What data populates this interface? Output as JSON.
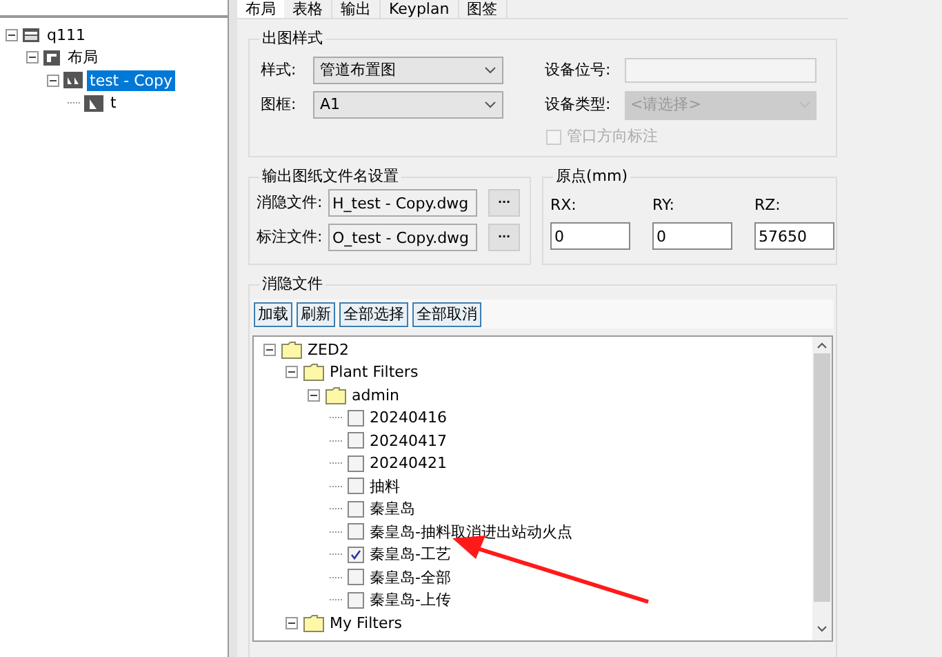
{
  "project_tree": [
    {
      "label": "q111",
      "kind": "project",
      "expanded": true,
      "selected": false,
      "children": [
        {
          "label": "布局",
          "kind": "layout",
          "expanded": true,
          "selected": false,
          "children": [
            {
              "label": "test - Copy",
              "kind": "drawing",
              "expanded": true,
              "selected": true,
              "children": [
                {
                  "label": "t",
                  "kind": "sheet",
                  "selected": false
                }
              ]
            }
          ]
        }
      ]
    }
  ],
  "tabs": [
    {
      "label": "布局",
      "selected": true
    },
    {
      "label": "表格",
      "selected": false
    },
    {
      "label": "输出",
      "selected": false
    },
    {
      "label": "Keyplan",
      "selected": false
    },
    {
      "label": "图签",
      "selected": false
    }
  ],
  "style_group": {
    "title": "出图样式",
    "style": {
      "label": "样式:",
      "value": "管道布置图"
    },
    "frame": {
      "label": "图框:",
      "value": "A1"
    },
    "equipment_tag": {
      "label": "设备位号:",
      "disabled": true
    },
    "equipment_type": {
      "label": "设备类型:",
      "placeholder": "<请选择>",
      "disabled": true
    },
    "nozzle_checkbox": {
      "label": "管口方向标注",
      "checked": false,
      "disabled": true
    }
  },
  "output_group": {
    "title": "输出图纸文件名设置",
    "rows": [
      {
        "label": "消隐文件:",
        "value": "H_test - Copy.dwg",
        "button": "···"
      },
      {
        "label": "标注文件:",
        "value": "O_test - Copy.dwg",
        "button": "···"
      }
    ]
  },
  "origin_group": {
    "title": "原点(mm)",
    "fields": [
      {
        "label": "RX:",
        "value": "0"
      },
      {
        "label": "RY:",
        "value": "0"
      },
      {
        "label": "RZ:",
        "value": "57650"
      }
    ]
  },
  "hidden_group": {
    "title": "消隐文件",
    "buttons": [
      "加载",
      "刷新",
      "全部选择",
      "全部取消"
    ],
    "tree": [
      {
        "label": "ZED2",
        "kind": "folder",
        "expanded": true,
        "children": [
          {
            "label": "Plant Filters",
            "kind": "folder",
            "expanded": true,
            "children": [
              {
                "label": "admin",
                "kind": "folder",
                "expanded": true,
                "children": [
                  {
                    "label": "20240416",
                    "kind": "item",
                    "checked": false
                  },
                  {
                    "label": "20240417",
                    "kind": "item",
                    "checked": false
                  },
                  {
                    "label": "20240421",
                    "kind": "item",
                    "checked": false
                  },
                  {
                    "label": "抽料",
                    "kind": "item",
                    "checked": false
                  },
                  {
                    "label": "秦皇岛",
                    "kind": "item",
                    "checked": false
                  },
                  {
                    "label": "秦皇岛-抽料取消进出站动火点",
                    "kind": "item",
                    "checked": false
                  },
                  {
                    "label": "秦皇岛-工艺",
                    "kind": "item",
                    "checked": true
                  },
                  {
                    "label": "秦皇岛-全部",
                    "kind": "item",
                    "checked": false
                  },
                  {
                    "label": "秦皇岛-上传",
                    "kind": "item",
                    "checked": false
                  }
                ]
              }
            ]
          },
          {
            "label": "My Filters",
            "kind": "folder",
            "expanded": true
          }
        ]
      }
    ]
  }
}
